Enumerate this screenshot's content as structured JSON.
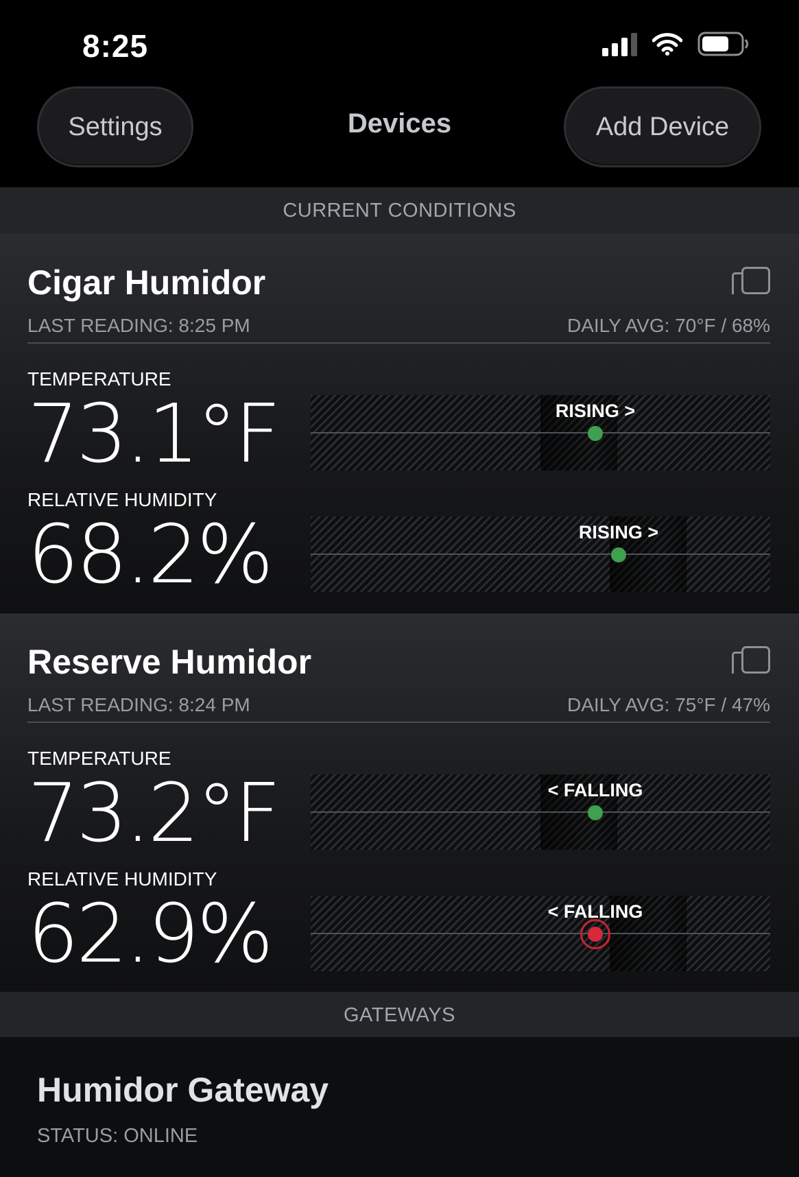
{
  "status_bar": {
    "time": "8:25"
  },
  "nav": {
    "settings_label": "Settings",
    "title": "Devices",
    "add_label": "Add Device"
  },
  "sections": {
    "current_conditions": "CURRENT CONDITIONS",
    "gateways": "GATEWAYS"
  },
  "devices": [
    {
      "name": "Cigar Humidor",
      "last_reading": "LAST READING: 8:25 PM",
      "daily_avg": "DAILY AVG: 70°F / 68%",
      "temperature": {
        "label": "TEMPERATURE",
        "value": "73.1°F",
        "trend": "RISING >",
        "status": "normal",
        "position": 0.62,
        "band_start": 0.5
      },
      "humidity": {
        "label": "RELATIVE HUMIDITY",
        "value": "68.2%",
        "trend": "RISING >",
        "status": "normal",
        "position": 0.67,
        "band_start": 0.65
      }
    },
    {
      "name": "Reserve Humidor",
      "last_reading": "LAST READING: 8:24 PM",
      "daily_avg": "DAILY AVG: 75°F / 47%",
      "temperature": {
        "label": "TEMPERATURE",
        "value": "73.2°F",
        "trend": "< FALLING",
        "status": "normal",
        "position": 0.62,
        "band_start": 0.5
      },
      "humidity": {
        "label": "RELATIVE HUMIDITY",
        "value": "62.9%",
        "trend": "< FALLING",
        "status": "alert",
        "position": 0.62,
        "band_start": 0.65
      }
    }
  ],
  "gateway": {
    "name": "Humidor Gateway",
    "status": "STATUS: ONLINE"
  },
  "colors": {
    "ok_dot": "#3fa04f",
    "alert_dot": "#d8283a",
    "background": "#000000"
  },
  "icons": [
    "signal-icon",
    "wifi-icon",
    "battery-icon",
    "copy-icon"
  ]
}
